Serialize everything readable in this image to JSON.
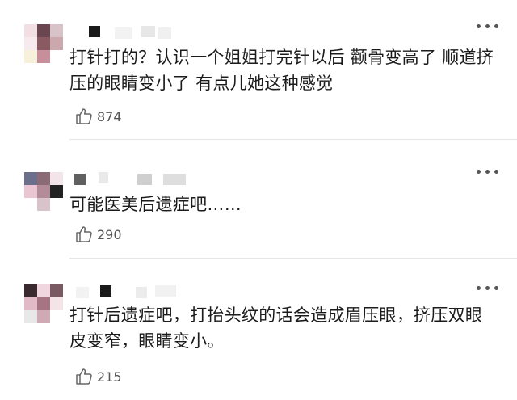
{
  "comments": [
    {
      "text": "打针打的？认识一个姐姐打完针以后 颧骨变高了 顺道挤压的眼睛变小了 有点儿她这种感觉",
      "likes": "874"
    },
    {
      "text": "可能医美后遗症吧……",
      "likes": "290"
    },
    {
      "text": "打针后遗症吧，打抬头纹的话会造成眉压眼，挤压双眼皮变窄，眼睛变小。",
      "likes": "215"
    }
  ],
  "icons": {
    "like": "thumbs-up-icon",
    "more": "more-dots-icon"
  },
  "colors": {
    "text": "#1b1b1b",
    "meta": "#555555",
    "divider": "#e6e6e6"
  }
}
